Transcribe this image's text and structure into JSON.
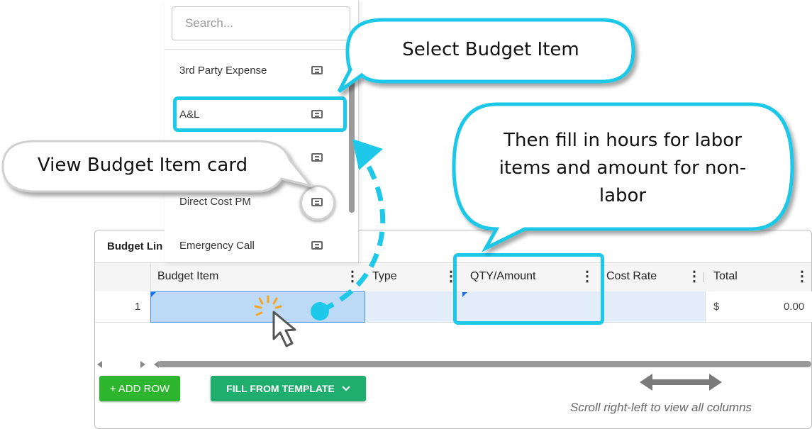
{
  "panel": {
    "title": "Budget Lin"
  },
  "grid": {
    "columns": [
      {
        "label": "Budget Item"
      },
      {
        "label": "Type"
      },
      {
        "label": "QTY/Amount"
      },
      {
        "label": "Cost Rate"
      },
      {
        "label": "Total"
      }
    ],
    "row": {
      "number": "1",
      "currency": "$",
      "total": "0.00"
    }
  },
  "dropdown": {
    "search_placeholder": "Search...",
    "items": [
      {
        "label": "3rd Party Expense"
      },
      {
        "label": "A&L"
      },
      {
        "label": ""
      },
      {
        "label": "Direct Cost PM"
      },
      {
        "label": "Emergency Call"
      }
    ]
  },
  "buttons": {
    "add_row": "+ ADD ROW",
    "fill_from_template": "FILL FROM TEMPLATE",
    "fill_chevron": "⌄"
  },
  "hint": "Scroll right-left to view all columns",
  "callouts": {
    "select_budget_item": "Select Budget Item",
    "view_card": "View Budget Item card",
    "fill_in_line1": "Then fill in hours for labor",
    "fill_in_line2": "items and amount for non-",
    "fill_in_line3": "labor"
  },
  "colors": {
    "highlight": "#1ec8e8",
    "add_row_green": "#2db52d",
    "fill_template_green": "#1fae6d",
    "selection_blue": "#bcdaf5"
  }
}
